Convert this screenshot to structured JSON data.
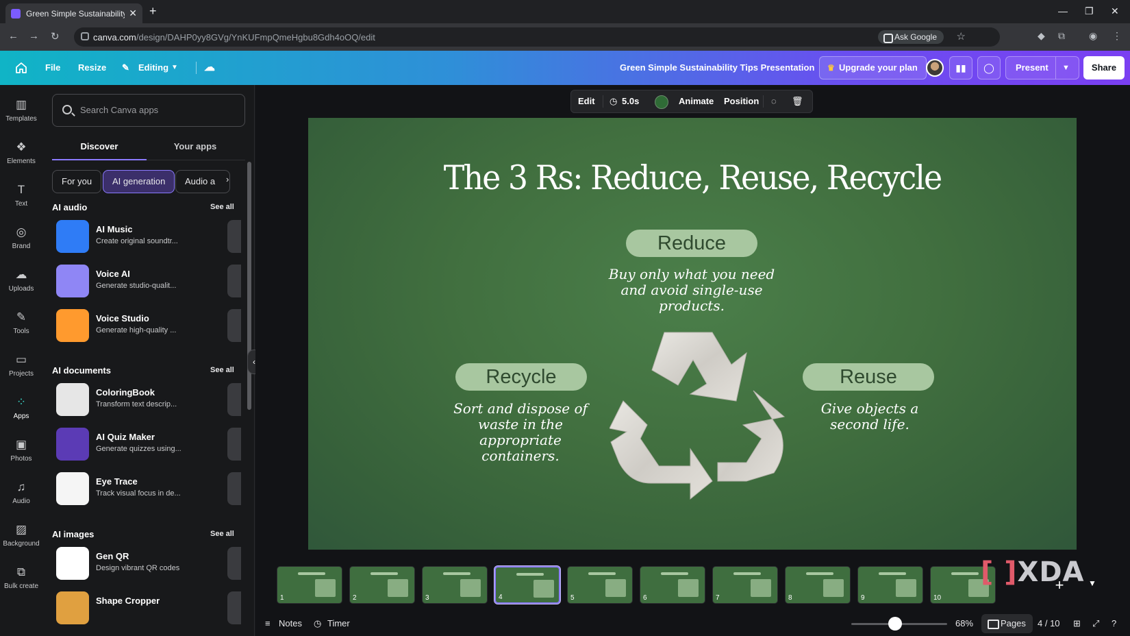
{
  "browser": {
    "tab_title": "Green Simple Sustainability Tip",
    "url_host": "canva.com",
    "url_path": "/design/DAHP0yy8GVg/YnKUFmpQmeHgbu8Gdh4oOQ/edit",
    "ask_google": "Ask Google"
  },
  "header": {
    "file": "File",
    "resize": "Resize",
    "editing": "Editing",
    "doc_title": "Green Simple Sustainability Tips Presentation",
    "upgrade": "Upgrade your plan",
    "present": "Present",
    "share": "Share"
  },
  "rail": [
    {
      "label": "Templates",
      "icon": "templates-icon",
      "glyph": "▥"
    },
    {
      "label": "Elements",
      "icon": "elements-icon",
      "glyph": "❖"
    },
    {
      "label": "Text",
      "icon": "text-icon",
      "glyph": "T"
    },
    {
      "label": "Brand",
      "icon": "brand-icon",
      "glyph": "◎"
    },
    {
      "label": "Uploads",
      "icon": "uploads-icon",
      "glyph": "☁"
    },
    {
      "label": "Tools",
      "icon": "tools-icon",
      "glyph": "✎"
    },
    {
      "label": "Projects",
      "icon": "projects-icon",
      "glyph": "▭"
    },
    {
      "label": "Apps",
      "icon": "apps-icon",
      "glyph": "⁘"
    },
    {
      "label": "Photos",
      "icon": "photos-icon",
      "glyph": "▣"
    },
    {
      "label": "Audio",
      "icon": "audio-icon",
      "glyph": "♫"
    },
    {
      "label": "Background",
      "icon": "background-icon",
      "glyph": "▨"
    },
    {
      "label": "Bulk create",
      "icon": "bulk-create-icon",
      "glyph": "⧉"
    }
  ],
  "panel": {
    "search_placeholder": "Search Canva apps",
    "tabs": [
      "Discover",
      "Your apps"
    ],
    "chips": [
      "For you",
      "AI generation",
      "Audio a"
    ],
    "see_all": "See all",
    "sections": [
      {
        "title": "AI audio",
        "apps": [
          {
            "name": "AI Music",
            "desc": "Create original soundtr...",
            "color": "#2f7cf6"
          },
          {
            "name": "Voice AI",
            "desc": "Generate studio-qualit...",
            "color": "#8f86f5"
          },
          {
            "name": "Voice Studio",
            "desc": "Generate high-quality ...",
            "color": "#ff9a2e"
          }
        ]
      },
      {
        "title": "AI documents",
        "apps": [
          {
            "name": "ColoringBook",
            "desc": "Transform text descrip...",
            "color": "#e6e6e6"
          },
          {
            "name": "AI Quiz Maker",
            "desc": "Generate quizzes using...",
            "color": "#5b3bb5"
          },
          {
            "name": "Eye Trace",
            "desc": "Track visual focus in de...",
            "color": "#f5f5f5"
          }
        ]
      },
      {
        "title": "AI images",
        "apps": [
          {
            "name": "Gen QR",
            "desc": "Design vibrant QR codes",
            "color": "#ffffff"
          },
          {
            "name": "Shape Cropper",
            "desc": "",
            "color": "#e0a040"
          }
        ]
      }
    ]
  },
  "toolbar": {
    "edit": "Edit",
    "duration": "5.0s",
    "animate": "Animate",
    "position": "Position",
    "color": "#2f6b36"
  },
  "slide": {
    "title": "The 3 Rs: Reduce, Reuse, Recycle",
    "reduce_label": "Reduce",
    "reduce_text": "Buy only what you need and avoid single-use products.",
    "recycle_label": "Recycle",
    "recycle_text": "Sort and dispose of waste in the appropriate containers.",
    "reuse_label": "Reuse",
    "reuse_text": "Give objects a second life.",
    "bg_color": "#416f3f"
  },
  "thumbnails": {
    "pages": [
      "1",
      "2",
      "3",
      "4",
      "5",
      "6",
      "7",
      "8",
      "9",
      "10"
    ],
    "active_index": 3,
    "watermark": "XDA"
  },
  "footer": {
    "notes": "Notes",
    "timer": "Timer",
    "zoom": "68%",
    "pages": "Pages",
    "page_indicator": "4 / 10"
  }
}
